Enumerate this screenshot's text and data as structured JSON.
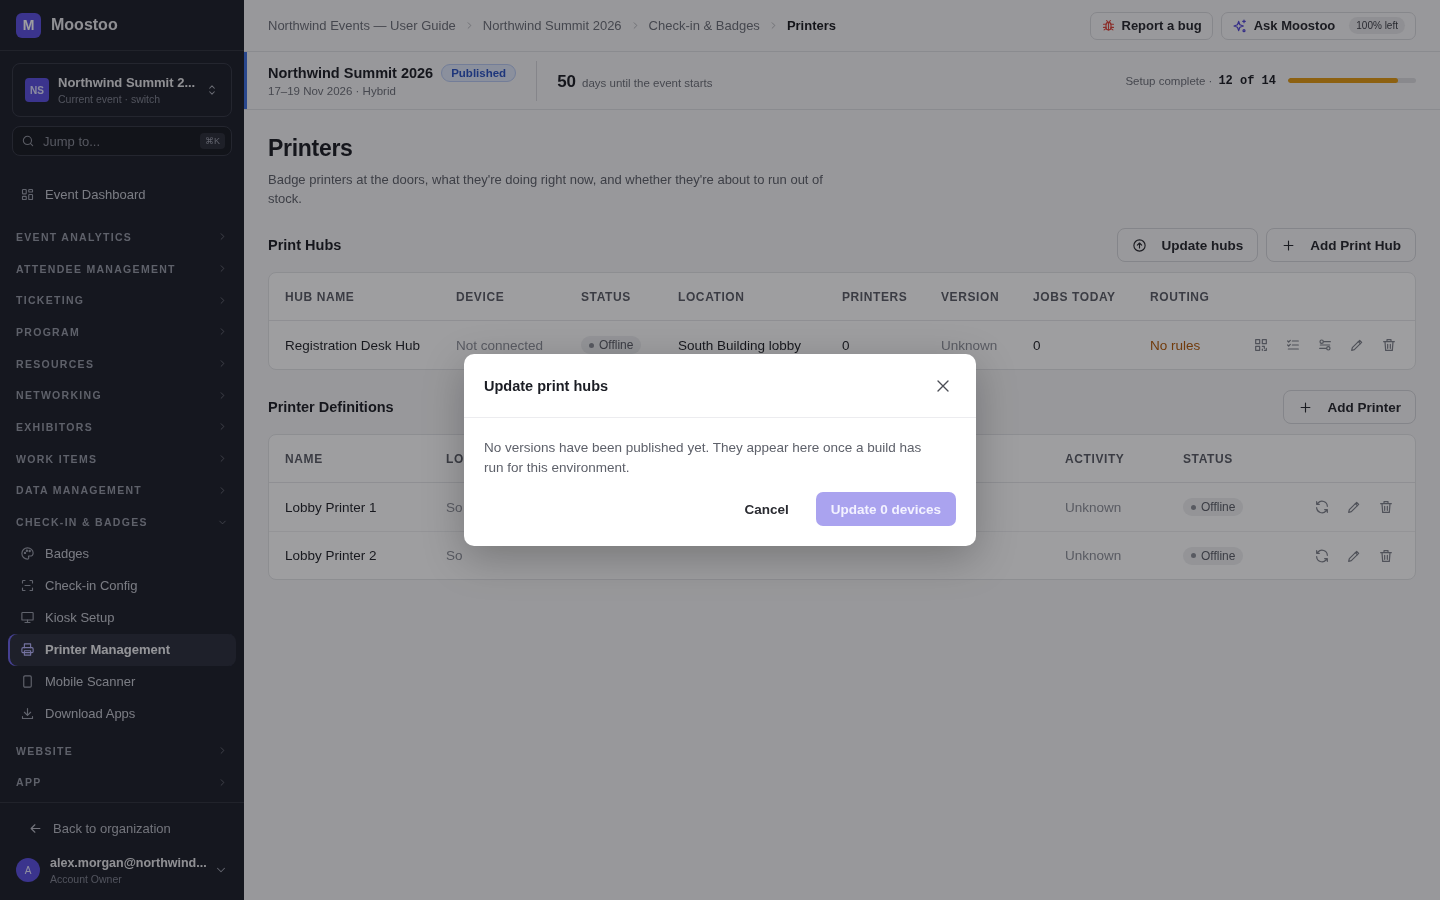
{
  "app": {
    "logo_letter": "M",
    "name": "Moostoo"
  },
  "event_switcher": {
    "avatar": "NS",
    "title": "Northwind Summit 2...",
    "subtitle": "Current event · switch"
  },
  "jump": {
    "placeholder": "Jump to...",
    "shortcut": "⌘K"
  },
  "nav": [
    {
      "kind": "link",
      "label": "Event Dashboard"
    },
    {
      "kind": "section",
      "label": "EVENT ANALYTICS",
      "expanded": false
    },
    {
      "kind": "section",
      "label": "ATTENDEE MANAGEMENT",
      "expanded": false
    },
    {
      "kind": "section",
      "label": "TICKETING",
      "expanded": false
    },
    {
      "kind": "section",
      "label": "PROGRAM",
      "expanded": false
    },
    {
      "kind": "section",
      "label": "RESOURCES",
      "expanded": false
    },
    {
      "kind": "section",
      "label": "NETWORKING",
      "expanded": false
    },
    {
      "kind": "section",
      "label": "EXHIBITORS",
      "expanded": false
    },
    {
      "kind": "section",
      "label": "WORK ITEMS",
      "expanded": false
    },
    {
      "kind": "section",
      "label": "DATA MANAGEMENT",
      "expanded": false
    },
    {
      "kind": "section",
      "label": "CHECK-IN & BADGES",
      "expanded": true,
      "children": [
        {
          "label": "Badges",
          "selected": false
        },
        {
          "label": "Check-in Config",
          "selected": false
        },
        {
          "label": "Kiosk Setup",
          "selected": false
        },
        {
          "label": "Printer Management",
          "selected": true
        },
        {
          "label": "Mobile Scanner",
          "selected": false
        },
        {
          "label": "Download Apps",
          "selected": false
        }
      ]
    },
    {
      "kind": "section",
      "label": "WEBSITE",
      "expanded": false
    },
    {
      "kind": "section",
      "label": "APP",
      "expanded": false
    }
  ],
  "footer": {
    "back": "Back to organization",
    "avatar": "A",
    "email": "alex.morgan@northwind...",
    "role": "Account Owner"
  },
  "breadcrumbs": [
    {
      "label": "Northwind Events — User Guide",
      "current": false
    },
    {
      "label": "Northwind Summit 2026",
      "current": false
    },
    {
      "label": "Check-in & Badges",
      "current": false
    },
    {
      "label": "Printers",
      "current": true
    }
  ],
  "top_actions": {
    "report": "Report a bug",
    "ask": "Ask Moostoo",
    "quota": "100% left"
  },
  "event_bar": {
    "title": "Northwind Summit 2026",
    "status": "Published",
    "dates": "17–19 Nov 2026 · Hybrid",
    "countdown": "50",
    "countdown_label": "days until the event starts",
    "setup_label": "Setup complete ·",
    "setup_count": "12 of 14",
    "level": 0.857
  },
  "page": {
    "title": "Printers",
    "description": "Badge printers at the doors, what they're doing right now, and whether they're about to run out of stock."
  },
  "hubs": {
    "title": "Print Hubs",
    "buttons": [
      {
        "kind": "update",
        "label": "Update hubs"
      },
      {
        "kind": "add",
        "label": "Add Print Hub"
      }
    ],
    "columns": [
      "HUB NAME",
      "DEVICE",
      "STATUS",
      "LOCATION",
      "PRINTERS",
      "VERSION",
      "JOBS TODAY",
      "ROUTING"
    ],
    "rows": [
      {
        "hub_name": "Registration Desk Hub",
        "device": "Not connected",
        "status": "Offline",
        "location": "South Building lobby",
        "printers": "0",
        "version": "Unknown",
        "jobs_today": "0",
        "routing": "No rules"
      }
    ]
  },
  "printers": {
    "title": "Printer Definitions",
    "button": "Add Printer",
    "columns": [
      "NAME",
      "LO",
      "ACTIVITY",
      "STATUS"
    ],
    "rows": [
      {
        "name": "Lobby Printer 1",
        "location": "So",
        "activity": "Unknown",
        "status": "Offline"
      },
      {
        "name": "Lobby Printer 2",
        "location": "So",
        "activity": "Unknown",
        "status": "Offline"
      }
    ]
  },
  "dialog": {
    "title": "Update print hubs",
    "body": "No versions have been published yet. They appear here once a build has run for this environment.",
    "buttons": [
      {
        "kind": "secondary",
        "label": "Cancel",
        "disabled": false
      },
      {
        "kind": "primary",
        "label": "Update 0 devices",
        "disabled": true
      }
    ]
  }
}
